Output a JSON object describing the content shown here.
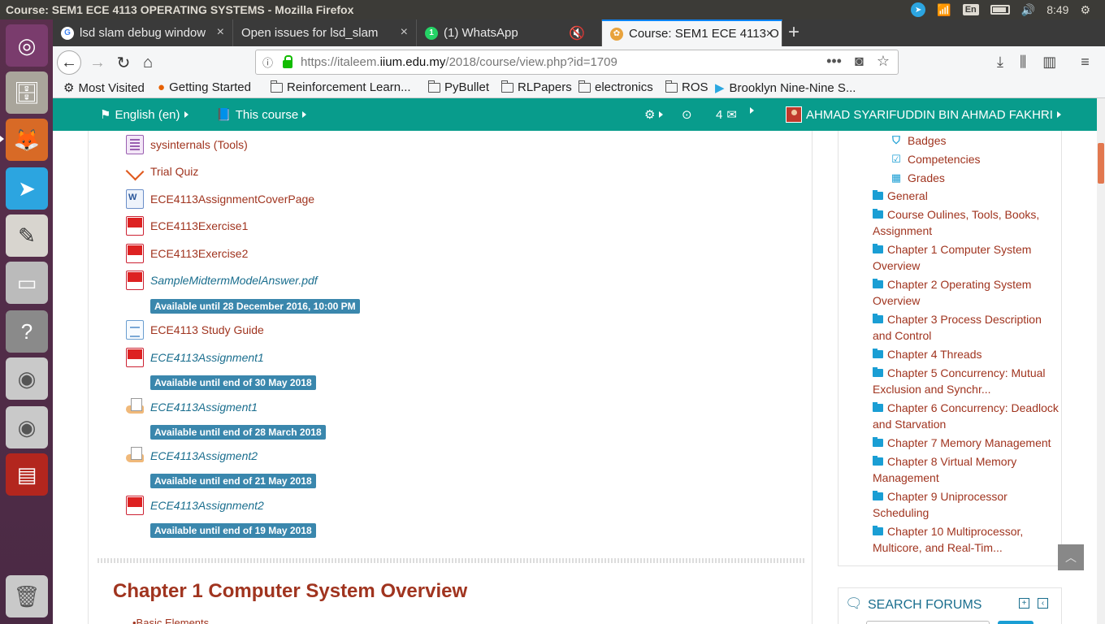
{
  "os": {
    "window_title": "Course: SEM1 ECE 4113 OPERATING SYSTEMS - Mozilla Firefox",
    "keyboard": "En",
    "clock": "8:49"
  },
  "tabs": [
    {
      "title": "lsd slam debug window",
      "icon": "google-icon"
    },
    {
      "title": "Open issues for lsd_slam",
      "icon": "github-icon"
    },
    {
      "title": "(1) WhatsApp",
      "icon": "whatsapp-icon"
    },
    {
      "title": "",
      "icon": "muted-audio-icon"
    },
    {
      "title": "Course: SEM1 ECE 4113 O",
      "icon": "moodle-icon"
    }
  ],
  "url": {
    "prefix": "https://italeem.",
    "host": "iium.edu.my",
    "path": "/2018/course/view.php?id=1709"
  },
  "bookmarks": [
    "Most Visited",
    "Getting Started",
    "Reinforcement Learn...",
    "PyBullet",
    "RLPapers",
    "electronics",
    "ROS",
    "Brooklyn Nine-Nine S..."
  ],
  "moodle_nav": {
    "language": "English (en)",
    "this_course": "This course",
    "msg_count": "4",
    "user": "AHMAD SYARIFUDDIN BIN AHMAD FAKHRI"
  },
  "activities": [
    {
      "label": "sysinternals (Tools)",
      "type": "file",
      "italic": false
    },
    {
      "label": "Trial Quiz",
      "type": "quiz",
      "italic": false
    },
    {
      "label": "ECE4113AssignmentCoverPage",
      "type": "doc",
      "italic": false
    },
    {
      "label": "ECE4113Exercise1",
      "type": "pdf",
      "italic": false
    },
    {
      "label": "ECE4113Exercise2",
      "type": "pdf",
      "italic": false
    },
    {
      "label": "SampleMidtermModelAnswer.pdf",
      "type": "pdf",
      "italic": true,
      "badge": "Available until 28 December 2016, 10:00 PM"
    },
    {
      "label": "ECE4113 Study Guide",
      "type": "page",
      "italic": false
    },
    {
      "label": "ECE4113Assignment1",
      "type": "pdf",
      "italic": true,
      "badge": "Available until end of 30 May 2018"
    },
    {
      "label": "ECE4113Assigment1",
      "type": "assign",
      "italic": true,
      "badge": "Available until end of 28 March 2018"
    },
    {
      "label": "ECE4113Assigment2",
      "type": "assign",
      "italic": true,
      "badge": "Available until end of 21 May 2018"
    },
    {
      "label": "ECE4113Assignment2",
      "type": "pdf",
      "italic": true,
      "badge": "Available until end of 19 May 2018"
    }
  ],
  "section": {
    "title": "Chapter 1 Computer System Overview",
    "first_item": "•Basic Elements"
  },
  "sidebar": {
    "sub_items": [
      "Badges",
      "Competencies",
      "Grades"
    ],
    "sections": [
      "General",
      "Course Oulines, Tools, Books, Assignment",
      "Chapter 1 Computer System Overview",
      "Chapter 2 Operating System Overview",
      "Chapter 3 Process Description and Control",
      "Chapter 4 Threads",
      "Chapter 5 Concurrency: Mutual Exclusion and Synchr...",
      "Chapter 6 Concurrency: Deadlock and Starvation",
      "Chapter 7 Memory Management",
      "Chapter 8 Virtual Memory Management",
      "Chapter 9 Uniprocessor Scheduling",
      "Chapter 10 Multiprocessor, Multicore, and Real-Tim..."
    ],
    "search_title": "SEARCH FORUMS"
  },
  "colors": {
    "teal": "#089c8c",
    "link": "#a0341f",
    "badge": "#3a87ad"
  }
}
